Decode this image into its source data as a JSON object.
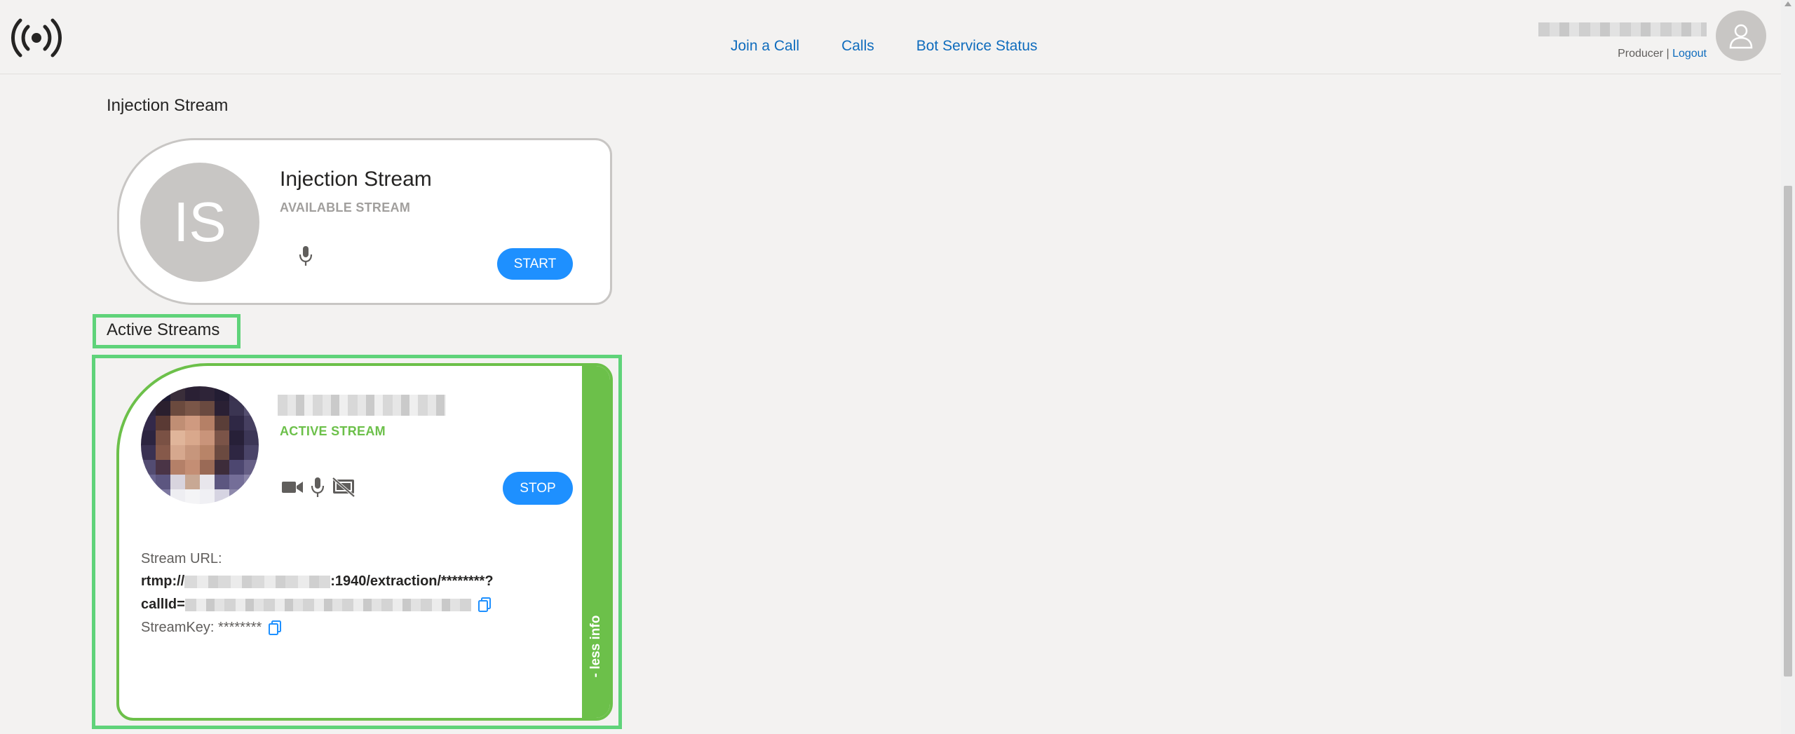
{
  "nav": {
    "links": [
      "Join a Call",
      "Calls",
      "Bot Service Status"
    ]
  },
  "user": {
    "role": "Producer",
    "separator": "|",
    "logout_label": "Logout"
  },
  "injection_section": {
    "title": "Injection Stream",
    "card": {
      "initials": "IS",
      "name": "Injection Stream",
      "status": "AVAILABLE STREAM",
      "button_label": "START"
    }
  },
  "active_section": {
    "title": "Active Streams",
    "card": {
      "status": "ACTIVE STREAM",
      "button_label": "STOP",
      "stream_url_label": "Stream URL:",
      "url_prefix": "rtmp://",
      "url_suffix": ":1940/extraction/********?",
      "callid_prefix": "callId=",
      "stream_key_label": "StreamKey: ********",
      "toggle_label": "- less info"
    }
  },
  "colors": {
    "accent": "#1e90ff",
    "link": "#0f6cbd",
    "active_green": "#6cc04a",
    "highlight_green": "#5fd37a",
    "available_gray": "#a19f9d"
  },
  "icons": {
    "logo": "broadcast-icon",
    "avatar": "user-avatar-icon",
    "mic": "microphone-icon",
    "camera": "video-camera-icon",
    "screen_off": "screen-share-off-icon",
    "copy": "copy-icon"
  }
}
